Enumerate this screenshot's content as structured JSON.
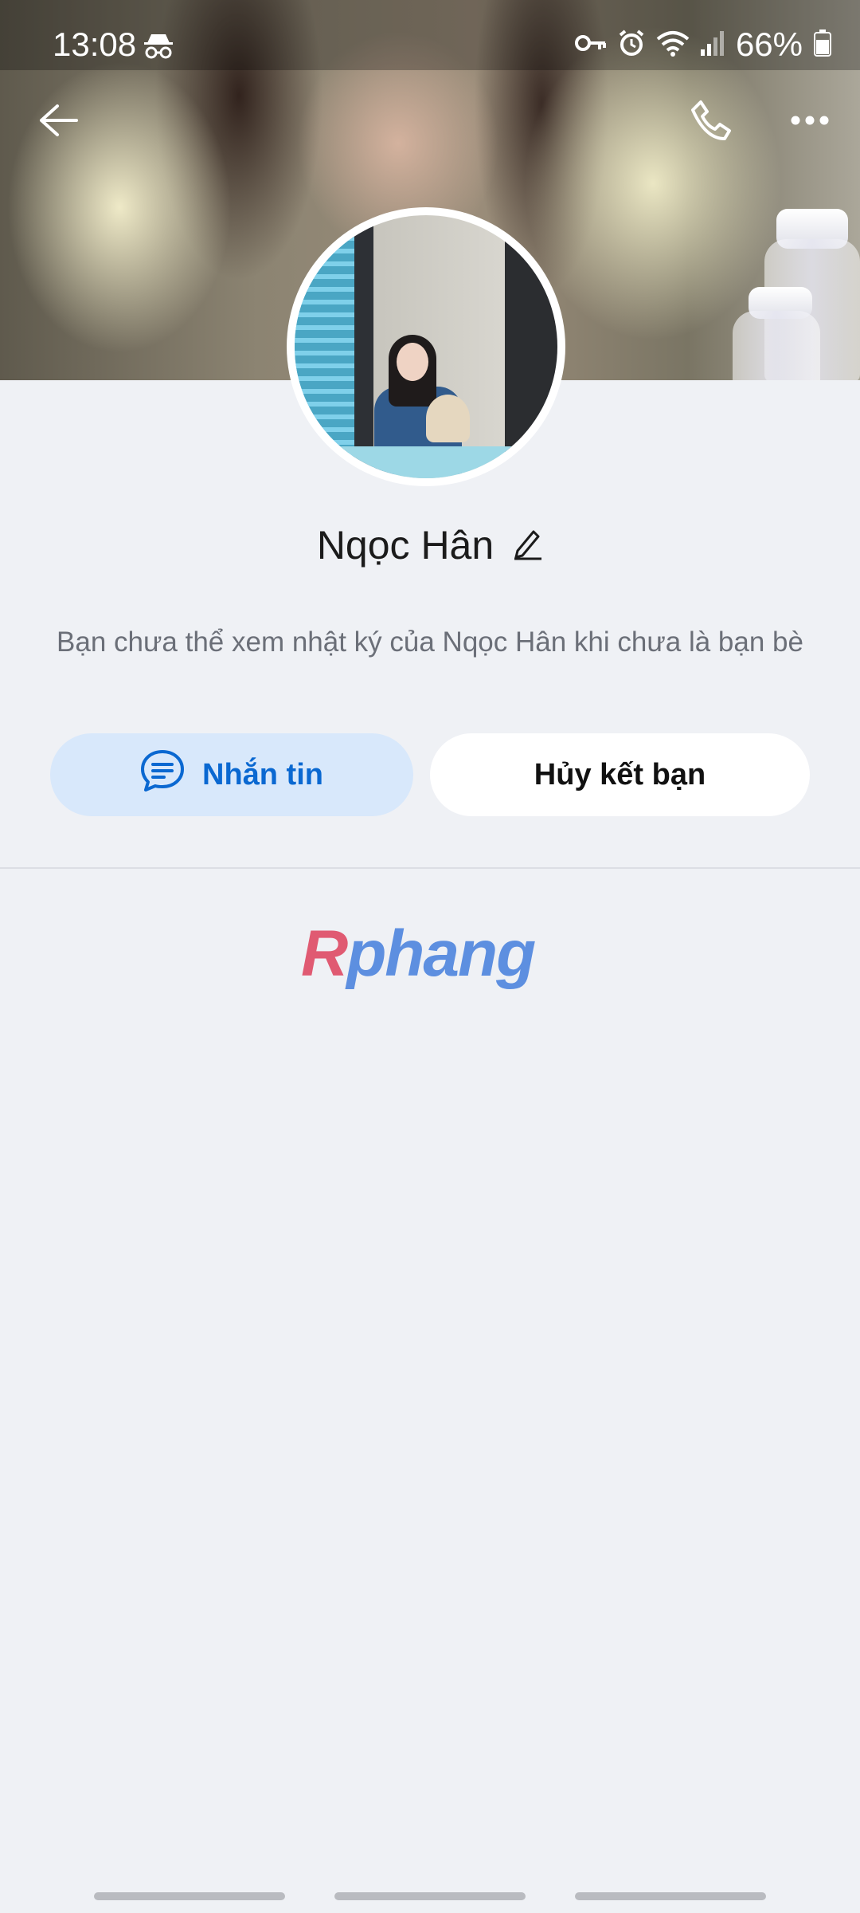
{
  "status_bar": {
    "time": "13:08",
    "battery": "66%",
    "icons": [
      "incognito-icon",
      "key-icon",
      "alarm-icon",
      "wifi-icon",
      "signal-icon",
      "battery-icon"
    ]
  },
  "header": {
    "back_icon": "back-arrow-icon",
    "call_icon": "phone-icon",
    "more_icon": "more-icon"
  },
  "profile": {
    "name": "Nqọc Hân",
    "notice": "Bạn chưa thể xem nhật ký của Nqọc Hân khi chưa là bạn bè"
  },
  "actions": {
    "message_label": "Nhắn tin",
    "unfriend_label": "Hủy kết bạn"
  },
  "colors": {
    "accent": "#0a68d1",
    "message_bg": "#d8e8fb",
    "page_bg": "#eff1f5"
  }
}
